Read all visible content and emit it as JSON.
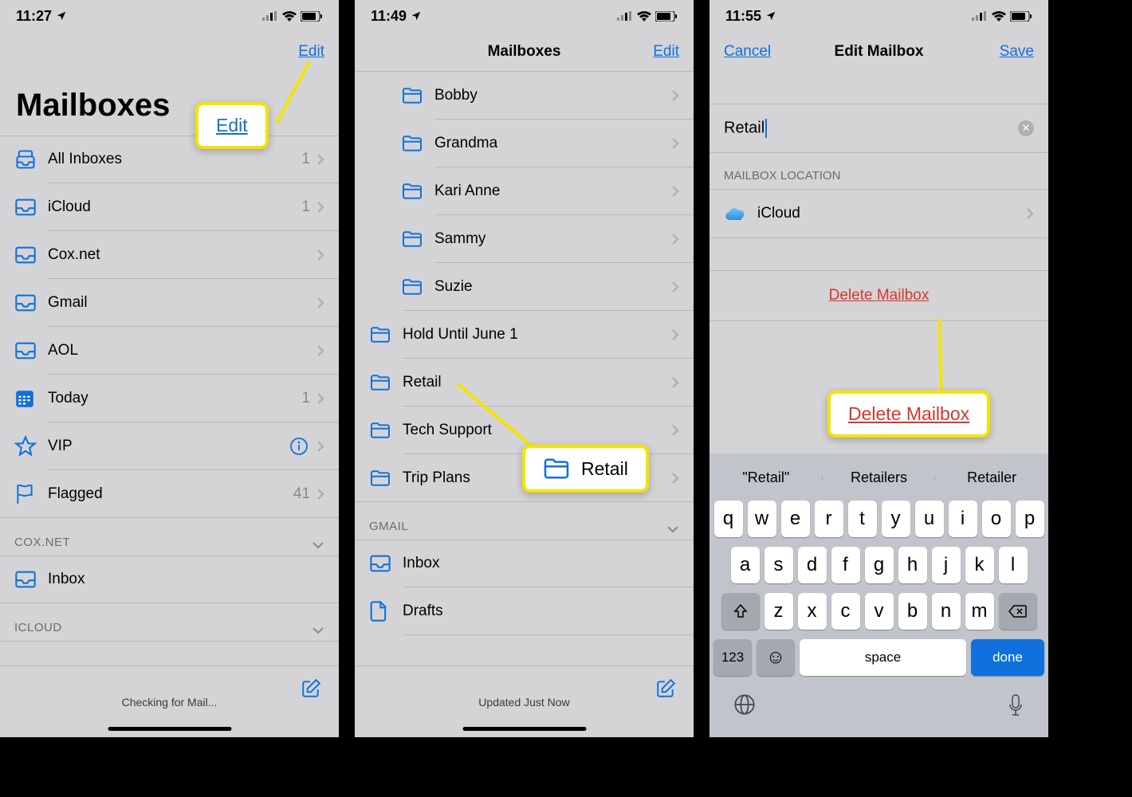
{
  "screens": {
    "s1": {
      "time": "11:27",
      "nav_edit": "Edit",
      "title": "Mailboxes",
      "rows": [
        {
          "label": "All Inboxes",
          "badge": "1",
          "chev": true,
          "icon": "tray-all"
        },
        {
          "label": "iCloud",
          "badge": "1",
          "chev": true,
          "icon": "tray"
        },
        {
          "label": "Cox.net",
          "badge": "",
          "chev": true,
          "icon": "tray"
        },
        {
          "label": "Gmail",
          "badge": "",
          "chev": true,
          "icon": "tray"
        },
        {
          "label": "AOL",
          "badge": "",
          "chev": true,
          "icon": "tray"
        },
        {
          "label": "Today",
          "badge": "1",
          "chev": true,
          "icon": "calendar"
        },
        {
          "label": "VIP",
          "badge": "",
          "chev": true,
          "icon": "star",
          "info": true
        },
        {
          "label": "Flagged",
          "badge": "41",
          "chev": true,
          "icon": "flag"
        }
      ],
      "section1": "COX.NET",
      "section1_rows": [
        {
          "label": "Inbox",
          "icon": "tray"
        }
      ],
      "section2": "ICLOUD",
      "status": "Checking for Mail...",
      "callout": "Edit"
    },
    "s2": {
      "time": "11:49",
      "nav_title": "Mailboxes",
      "nav_edit": "Edit",
      "rows": [
        {
          "label": "Bobby"
        },
        {
          "label": "Grandma"
        },
        {
          "label": "Kari Anne"
        },
        {
          "label": "Sammy"
        },
        {
          "label": "Suzie"
        },
        {
          "label": "Hold Until June 1",
          "unindent": true
        },
        {
          "label": "Retail",
          "unindent": true
        },
        {
          "label": "Tech Support",
          "unindent": true
        },
        {
          "label": "Trip Plans",
          "unindent": true
        }
      ],
      "section1": "GMAIL",
      "section1_rows": [
        {
          "label": "Inbox",
          "icon": "tray"
        },
        {
          "label": "Drafts",
          "icon": "doc"
        }
      ],
      "status": "Updated Just Now",
      "callout": "Retail"
    },
    "s3": {
      "time": "11:55",
      "nav_cancel": "Cancel",
      "nav_title": "Edit Mailbox",
      "nav_save": "Save",
      "input_value": "Retail",
      "section_label": "MAILBOX LOCATION",
      "location": "iCloud",
      "delete": "Delete Mailbox",
      "callout": "Delete Mailbox",
      "suggestions": [
        "\"Retail\"",
        "Retailers",
        "Retailer"
      ],
      "kb_rows": [
        [
          "q",
          "w",
          "e",
          "r",
          "t",
          "y",
          "u",
          "i",
          "o",
          "p"
        ],
        [
          "a",
          "s",
          "d",
          "f",
          "g",
          "h",
          "j",
          "k",
          "l"
        ],
        [
          "z",
          "x",
          "c",
          "v",
          "b",
          "n",
          "m"
        ]
      ],
      "kb_num": "123",
      "kb_space": "space",
      "kb_done": "done"
    }
  }
}
